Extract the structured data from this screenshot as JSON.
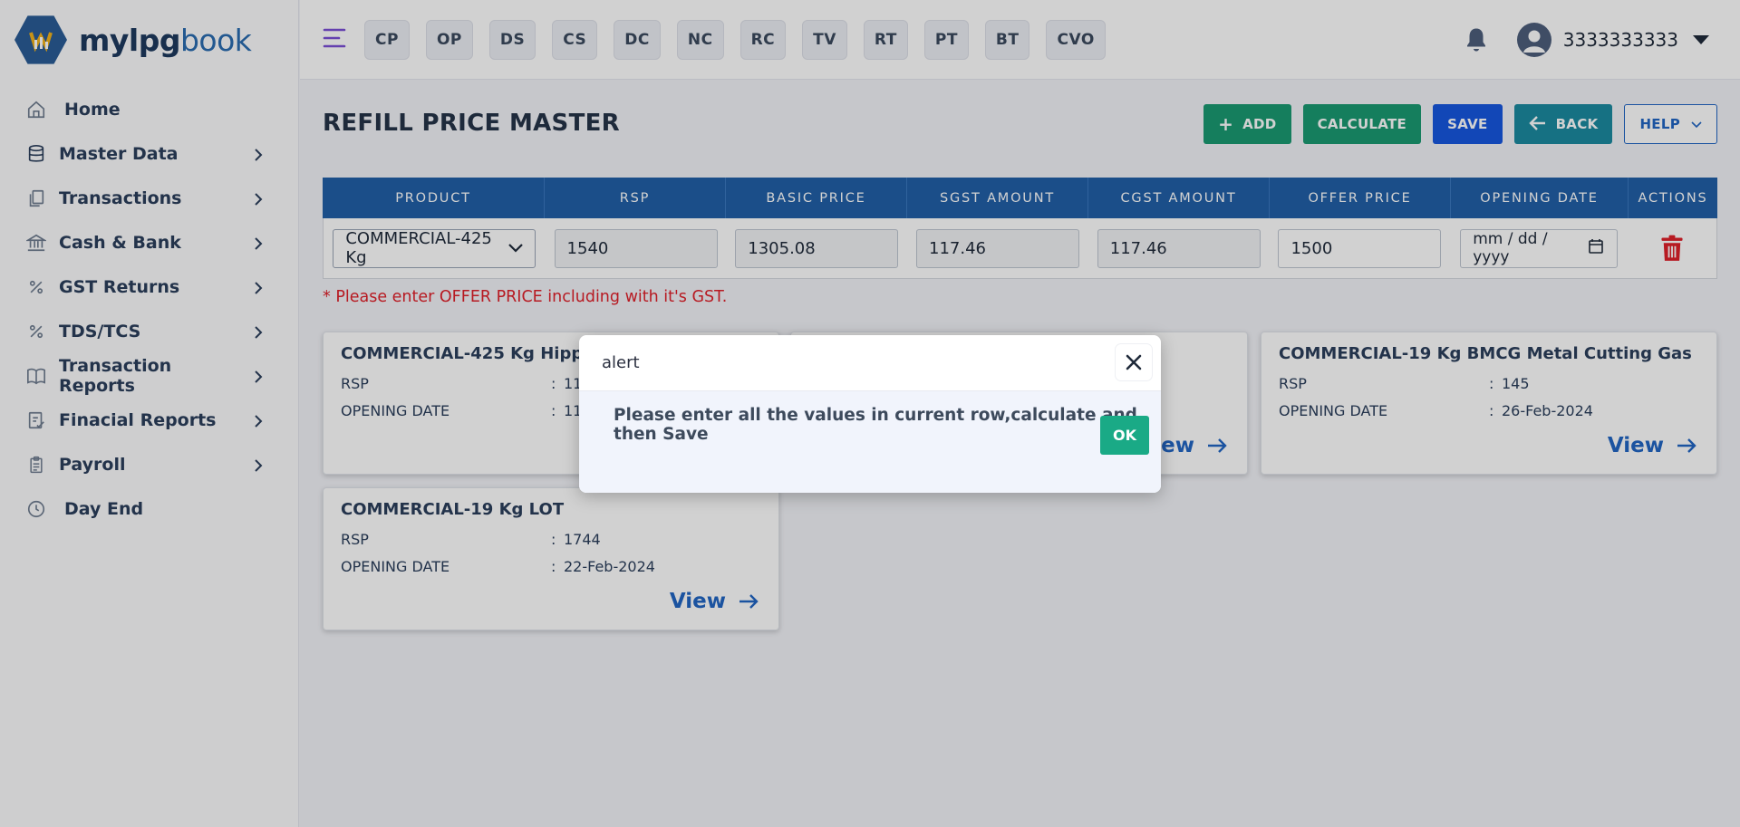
{
  "brand": {
    "name_part1": "mylpg",
    "name_part2": "book"
  },
  "sidebar": {
    "items": [
      {
        "label": "Home",
        "icon": "home-icon",
        "has_children": false
      },
      {
        "label": "Master Data",
        "icon": "database-icon",
        "has_children": true
      },
      {
        "label": "Transactions",
        "icon": "documents-icon",
        "has_children": true
      },
      {
        "label": "Cash & Bank",
        "icon": "bank-icon",
        "has_children": true
      },
      {
        "label": "GST Returns",
        "icon": "percent-icon",
        "has_children": true
      },
      {
        "label": "TDS/TCS",
        "icon": "percent-icon",
        "has_children": true
      },
      {
        "label": "Transaction Reports",
        "icon": "book-icon",
        "has_children": true
      },
      {
        "label": "Finacial Reports",
        "icon": "checklist-icon",
        "has_children": true
      },
      {
        "label": "Payroll",
        "icon": "clipboard-icon",
        "has_children": true
      },
      {
        "label": "Day End",
        "icon": "clock-icon",
        "has_children": false
      }
    ]
  },
  "topbar": {
    "chips": [
      "CP",
      "OP",
      "DS",
      "CS",
      "DC",
      "NC",
      "RC",
      "TV",
      "RT",
      "PT",
      "BT",
      "CVO"
    ],
    "user": "3333333333"
  },
  "page": {
    "title": "REFILL PRICE MASTER",
    "buttons": {
      "add": "ADD",
      "calculate": "CALCULATE",
      "save": "SAVE",
      "back": "BACK",
      "help": "HELP"
    }
  },
  "grid": {
    "columns": [
      "PRODUCT",
      "RSP",
      "BASIC PRICE",
      "SGST AMOUNT",
      "CGST AMOUNT",
      "OFFER PRICE",
      "OPENING DATE",
      "ACTIONS"
    ],
    "row": {
      "product": "COMMERCIAL-425 Kg",
      "rsp": "1540",
      "basic_price": "1305.08",
      "sgst_amount": "117.46",
      "cgst_amount": "117.46",
      "offer_price": "1500",
      "opening_date_placeholder": "mm / dd / yyyy"
    },
    "error": "* Please enter OFFER PRICE including with it's GST."
  },
  "cards": [
    {
      "title": "COMMERCIAL-425 Kg Hippo",
      "rsp_label": "RSP",
      "rsp": "11",
      "date_label": "OPENING DATE",
      "date": "11",
      "view": "View"
    },
    {
      "title": "",
      "rsp_label": "",
      "rsp": "",
      "date_label": "",
      "date": "",
      "view": "View"
    },
    {
      "title": "COMMERCIAL-19 Kg BMCG Metal Cutting Gas",
      "rsp_label": "RSP",
      "rsp": "145",
      "date_label": "OPENING DATE",
      "date": "26-Feb-2024",
      "view": "View"
    },
    {
      "title": "COMMERCIAL-19 Kg LOT",
      "rsp_label": "RSP",
      "rsp": "1744",
      "date_label": "OPENING DATE",
      "date": "22-Feb-2024",
      "view": "View"
    }
  ],
  "modal": {
    "title": "alert",
    "message": "Please enter all the values in current row,calculate and then Save",
    "ok": "OK"
  },
  "colors": {
    "primary_header": "#2160a8",
    "green": "#1a9a72",
    "blue": "#1657e0",
    "teal": "#1b8aa0",
    "error": "#e0202a"
  },
  "colon": ":"
}
